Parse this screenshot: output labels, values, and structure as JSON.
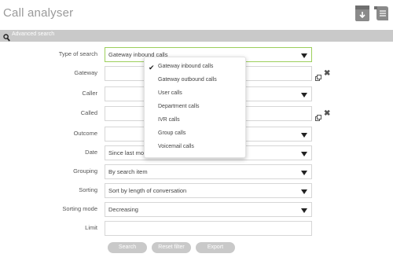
{
  "header": {
    "title": "Call analyser"
  },
  "search_bar": {
    "label": "Advanced search"
  },
  "form": {
    "type_of_search": {
      "label": "Type of search",
      "value": "Gateway inbound calls"
    },
    "gateway": {
      "label": "Gateway",
      "value": ""
    },
    "caller": {
      "label": "Caller",
      "value": ""
    },
    "called": {
      "label": "Called",
      "value": ""
    },
    "outcome": {
      "label": "Outcome",
      "value": ""
    },
    "date": {
      "label": "Date",
      "value": "Since last month"
    },
    "grouping": {
      "label": "Grouping",
      "value": "By search item"
    },
    "sorting": {
      "label": "Sorting",
      "value": "Sort by length of conversation"
    },
    "sorting_mode": {
      "label": "Sorting mode",
      "value": "Decreasing"
    },
    "limit": {
      "label": "Limit",
      "value": ""
    }
  },
  "dropdown": {
    "check_glyph": "✔",
    "options": [
      "Gateway inbound calls",
      "Gateway outbound calls",
      "User calls",
      "Department calls",
      "IVR calls",
      "Group calls",
      "Voicemail calls"
    ],
    "selected_index": 0
  },
  "buttons": {
    "search": "Search",
    "reset": "Reset filter",
    "export": "Export"
  },
  "icons": {
    "clear": "✖"
  },
  "colors": {
    "accent_border": "#9ccf5b",
    "bar": "#c9c9c9",
    "icon": "#8a8a8a"
  }
}
